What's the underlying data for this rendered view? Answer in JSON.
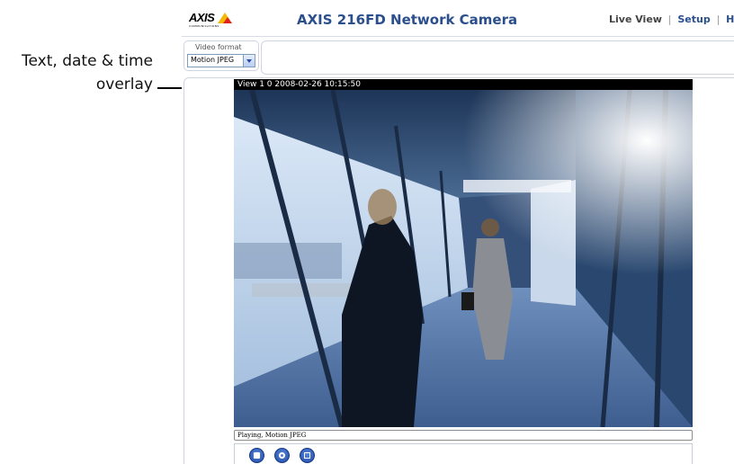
{
  "annotation": {
    "line1": "Text, date & time",
    "line2": "overlay"
  },
  "header": {
    "logo_text": "AXIS",
    "logo_subtext": "COMMUNICATIONS",
    "title": "AXIS 216FD Network Camera",
    "nav": [
      {
        "label": "Live View"
      },
      {
        "label": "Setup"
      },
      {
        "label": "Help"
      }
    ],
    "separator": "|"
  },
  "video_format": {
    "label": "Video format",
    "selected": "Motion JPEG"
  },
  "video": {
    "overlay_text": "View 1 0 2008-02-26 10:15:50",
    "status": "Playing, Motion JPEG"
  },
  "controls": [
    {
      "icon": "stop-icon"
    },
    {
      "icon": "snapshot-icon"
    },
    {
      "icon": "fullscreen-icon"
    }
  ],
  "colors": {
    "title_blue": "#2b4f8c",
    "logo_yellow": "#f5b800",
    "logo_red": "#e2231a",
    "overlay_bar": "#000000",
    "control_blue": "#1f4aa8"
  }
}
